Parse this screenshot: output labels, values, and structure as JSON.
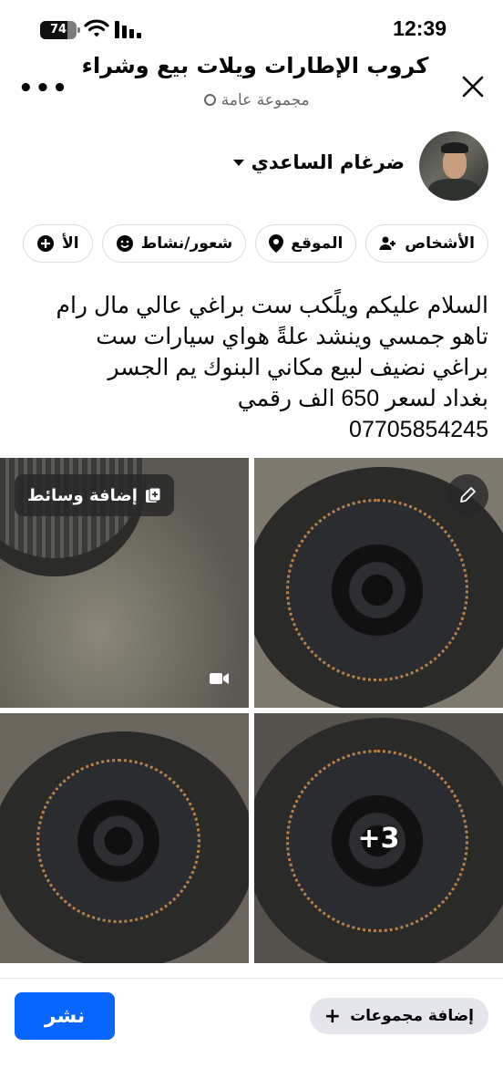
{
  "status_bar": {
    "battery": "74",
    "battery_level": 0.74,
    "time": "12:39"
  },
  "header": {
    "group_name": "كروب الإطارات ويلات بيع وشراء",
    "privacy": "مجموعة عامة",
    "more_icon": "more-dots-icon",
    "close_icon": "close-icon"
  },
  "author": {
    "name": "ضرغام الساعدي"
  },
  "chips": [
    {
      "label": "الأشخاص",
      "icon": "people-icon"
    },
    {
      "label": "الموقع",
      "icon": "location-pin-icon"
    },
    {
      "label": "شعور/نشاط",
      "icon": "smiley-icon"
    },
    {
      "label": "الأ",
      "icon": "plus-circle-icon"
    }
  ],
  "post_lines": [
    "السلام عليكم ويلًكب ست براغي عالي مال رام",
    "تاهو جمسي وينشد علةً هواي سيارات ست",
    "براغي نضيف لبيع مكاني البنوك يم الجسر",
    "بغداد لسعر 650 الف  رقمي",
    "07705854245"
  ],
  "media": {
    "add_media_label": "إضافة وسائط",
    "more_count": "+3"
  },
  "footer": {
    "post_button": "نشر",
    "add_groups": "إضافة مجموعات"
  },
  "colors": {
    "primary": "#0866ff",
    "muted": "#65676b",
    "chip_border": "#dadde1"
  }
}
